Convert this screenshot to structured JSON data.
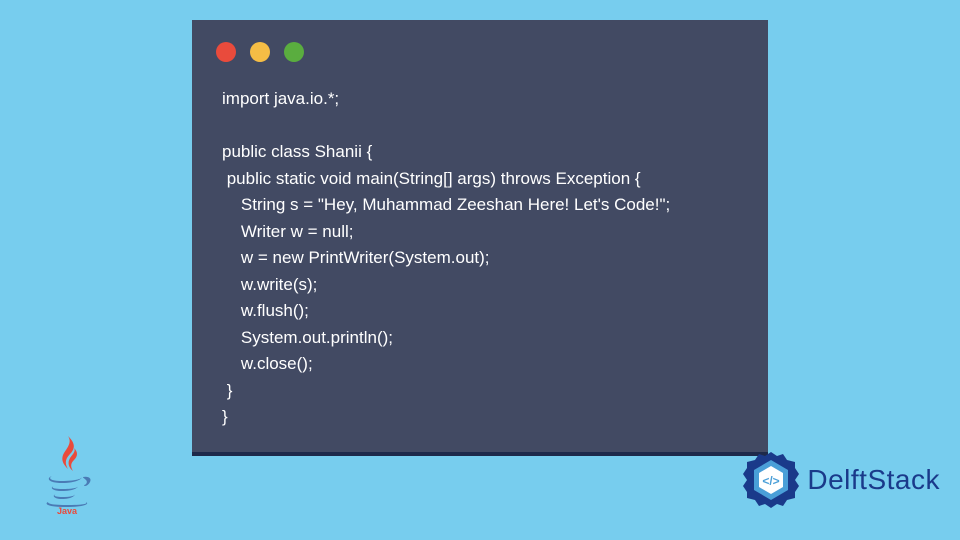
{
  "code": {
    "lines": [
      "import java.io.*;",
      "",
      "public class Shanii {",
      " public static void main(String[] args) throws Exception {",
      "    String s = \"Hey, Muhammad Zeeshan Here! Let's Code!\";",
      "    Writer w = null;",
      "    w = new PrintWriter(System.out);",
      "    w.write(s);",
      "    w.flush();",
      "    System.out.println();",
      "    w.close();",
      " }",
      "}"
    ]
  },
  "logos": {
    "java_label": "Java",
    "delftstack_label": "DelftStack"
  },
  "colors": {
    "background": "#77cdee",
    "window_bg": "#424a63",
    "window_border": "#1e2a4a",
    "dot_red": "#e94b3c",
    "dot_yellow": "#f5bd45",
    "dot_green": "#5aad3f",
    "delft_blue": "#1a3a8a"
  }
}
